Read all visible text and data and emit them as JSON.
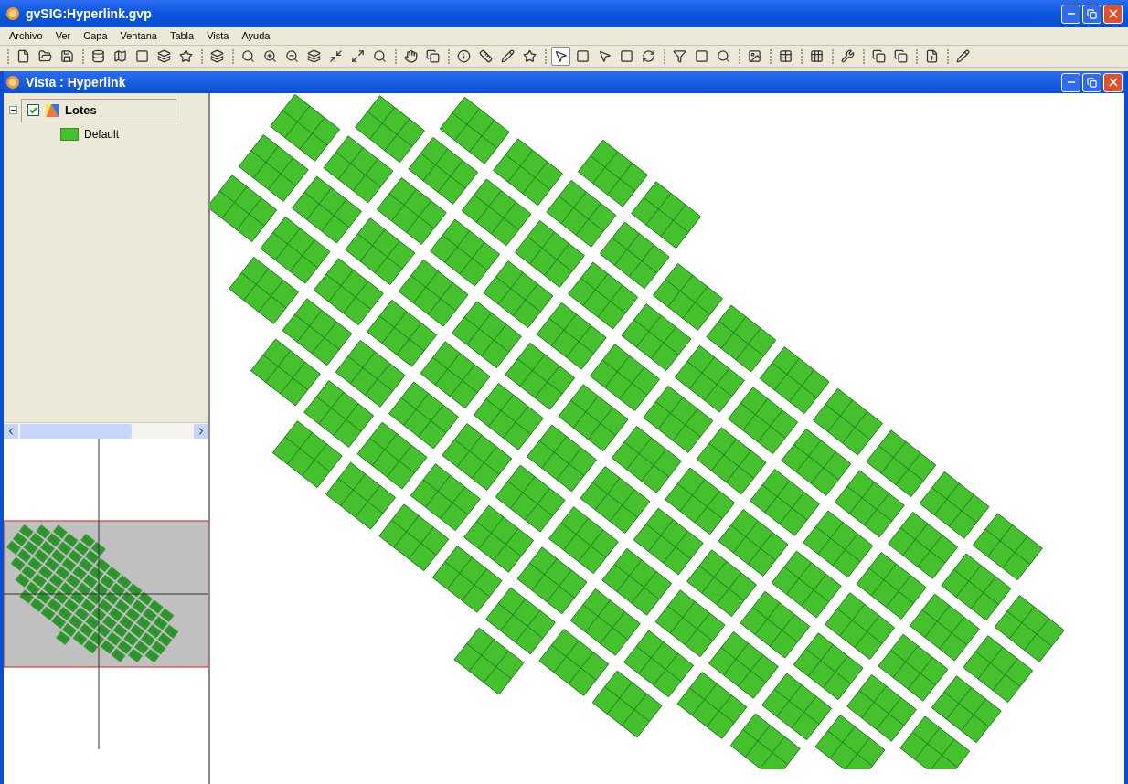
{
  "window": {
    "title": "gvSIG:Hyperlink.gvp"
  },
  "menu": [
    "Archivo",
    "Ver",
    "Capa",
    "Ventana",
    "Tabla",
    "Vista",
    "Ayuda"
  ],
  "toolbar": [
    [
      {
        "selected": false
      },
      {
        "selected": false
      },
      {
        "selected": false
      }
    ],
    [
      {
        "selected": false
      },
      {
        "selected": false
      },
      {
        "selected": false
      },
      {
        "selected": false
      },
      {
        "selected": false
      }
    ],
    [
      {
        "selected": false
      }
    ],
    [
      {
        "selected": false
      },
      {
        "selected": false
      },
      {
        "selected": false
      },
      {
        "selected": false
      },
      {
        "selected": false
      },
      {
        "selected": false
      },
      {
        "selected": false
      }
    ],
    [
      {
        "selected": false
      },
      {
        "selected": false
      }
    ],
    [
      {
        "selected": false
      },
      {
        "selected": false
      },
      {
        "selected": false
      },
      {
        "selected": false
      }
    ],
    [
      {
        "selected": true
      },
      {
        "selected": false
      },
      {
        "selected": false
      },
      {
        "selected": false
      },
      {
        "selected": false
      }
    ],
    [
      {
        "selected": false
      },
      {
        "selected": false
      },
      {
        "selected": false
      }
    ],
    [
      {
        "selected": false
      }
    ],
    [
      {
        "selected": false
      }
    ],
    [
      {
        "selected": false
      }
    ],
    [
      {
        "selected": false
      }
    ],
    [
      {
        "selected": false
      },
      {
        "selected": false
      }
    ],
    [
      {
        "selected": false
      }
    ],
    [
      {
        "selected": false
      }
    ]
  ],
  "view": {
    "title": "Vista : Hyperlink",
    "layers": [
      {
        "name": "Lotes",
        "checked": true,
        "expanded": true,
        "symbols": [
          {
            "label": "Default",
            "color": "#44c12c"
          }
        ]
      }
    ]
  }
}
